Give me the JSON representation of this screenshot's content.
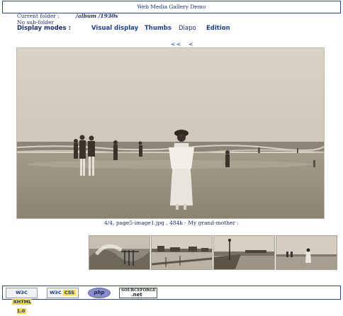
{
  "header": {
    "title": "Web Media Gallery Demo"
  },
  "folder": {
    "current_label": "Current folder :",
    "current_path": "/album /1930s",
    "subfolder_text": "No sub-folder"
  },
  "modes": {
    "label": "Display modes :",
    "items": [
      "Visual display",
      "Thumbs",
      "Diapo",
      "Edition"
    ]
  },
  "pager": {
    "first": "<<",
    "prev": "<"
  },
  "photo": {
    "caption": "4/4, page5-image1.jpg , 484k - My grand-mother :"
  },
  "thumbnails": [
    {
      "subject": "waves-pier-thumbnail"
    },
    {
      "subject": "beach-boardwalk-thumbnail"
    },
    {
      "subject": "pier-lamppost-thumbnail"
    },
    {
      "subject": "beach-walker-thumbnail"
    }
  ],
  "footer": {
    "badges": [
      {
        "name": "w3c-xhtml-badge",
        "w3c": "W3C",
        "text": "XHTML 1.0"
      },
      {
        "name": "w3c-css-badge",
        "w3c": "W3C",
        "text": "CSS"
      },
      {
        "name": "php-badge",
        "text": "php"
      },
      {
        "name": "sourceforge-badge",
        "small": "SOURCEFORGE",
        "big": ".net"
      }
    ]
  },
  "colors": {
    "frame_border": "#24468a",
    "link": "#1c3f8a",
    "text": "#1c2c66"
  }
}
